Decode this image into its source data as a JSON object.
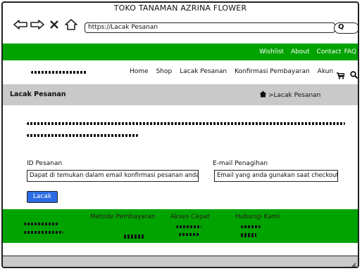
{
  "browser": {
    "title": "TOKO TANAMAN AZRINA FLOWER",
    "url": "https://Lacak Pesanan",
    "search_glyph": "Q"
  },
  "topbar": {
    "links": [
      "Wishlist",
      "About",
      "Contact",
      "FAQ"
    ]
  },
  "menu": {
    "items": [
      "Home",
      "Shop",
      "Lacak Pesanan",
      "Konfirmasi Pembayaran",
      "Akun"
    ]
  },
  "breadcrumb": {
    "title": "Lacak Pesanan",
    "path": ">Lacak Pesanan"
  },
  "form": {
    "order_id_label": "ID Pesanan",
    "order_id_placeholder": "Dapat di temukan dalam email konfirmasi pesanan anda",
    "email_label": "E-mail Penagihan",
    "email_placeholder": "Email yang anda gunakan saat checkout",
    "submit_label": "Lacak"
  },
  "footer": {
    "headings": [
      "Metode Pembayaran",
      "Akses Cepat",
      "Hubungi Kami"
    ]
  },
  "colors": {
    "green": "#00a300",
    "gray": "#c9c9c9",
    "button_blue": "#2d6be4"
  },
  "icons": [
    "back-arrow-icon",
    "forward-arrow-icon",
    "close-icon",
    "home-icon",
    "cart-icon",
    "search-icon"
  ]
}
